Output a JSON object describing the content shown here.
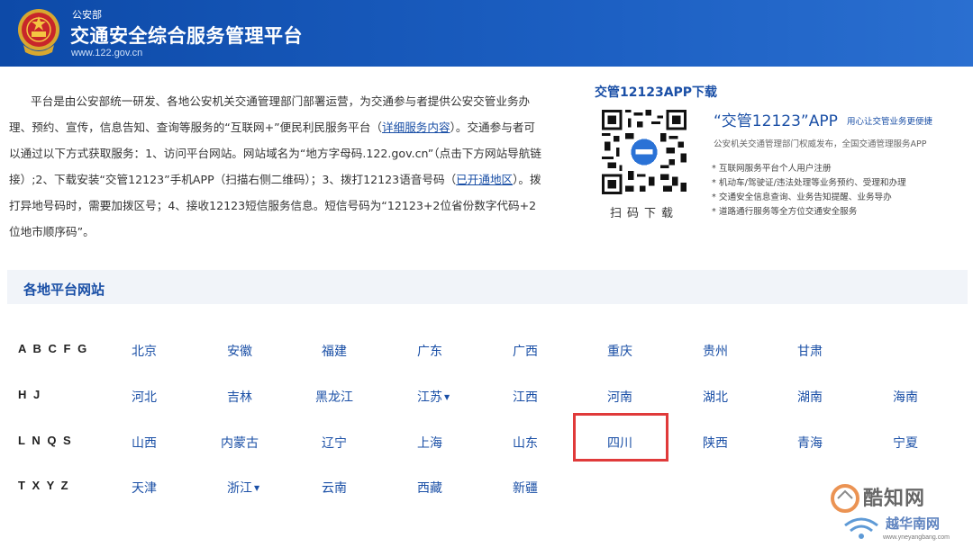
{
  "header": {
    "dept": "公安部",
    "title": "交通安全综合服务管理平台",
    "url": "www.122.gov.cn"
  },
  "intro": {
    "p1": "平台是由公安部统一研发、各地公安机关交通管理部门部署运营，为交通参与者提供公安交管业务办理、预约、宣传，信息告知、查询等服务的“互联网+”便民利民服务平台（",
    "link1": "详细服务内容",
    "p2": "）。交通参与者可以通过以下方式获取服务：1、访问平台网站。网站域名为“地方字母码.122.gov.cn”（点击下方网站导航链接）;2、下载安装“交管12123”手机APP（扫描右侧二维码）；3、拨打12123语音号码（",
    "link2": "已开通地区",
    "p3": "）。拨打异地号码时，需要加拨区号；4、接收12123短信服务信息。短信号码为“12123+2位省份数字代码+2位地市顺序码”。"
  },
  "app": {
    "title": "交管12123APP下载",
    "scan": "扫码下载",
    "name": "“交管12123”APP",
    "slogan": "用心让交管业务更便捷",
    "desc": "公安机关交通管理部门权威发布，全国交通管理服务APP",
    "features": [
      "* 互联网服务平台个人用户注册",
      "* 机动车/驾驶证/违法处理等业务预约、受理和办理",
      "* 交通安全信息查询、业务告知提醒、业务导办",
      "* 道路通行服务等全方位交通安全服务"
    ]
  },
  "section": {
    "title": "各地平台网站"
  },
  "groups": [
    "A B C F G",
    "H J",
    "L N Q S",
    "T X Y Z"
  ],
  "provinces": {
    "r0": [
      "北京",
      "安徽",
      "福建",
      "广东",
      "广西",
      "重庆",
      "贵州",
      "甘肃"
    ],
    "r1": [
      "河北",
      "吉林",
      "黑龙江",
      "江苏",
      "江西",
      "河南",
      "湖北",
      "湖南",
      "海南"
    ],
    "r2": [
      "山西",
      "内蒙古",
      "辽宁",
      "上海",
      "山东",
      "四川",
      "陕西",
      "青海",
      "宁夏"
    ],
    "r3": [
      "天津",
      "浙江",
      "云南",
      "西藏",
      "新疆"
    ]
  },
  "dropdown_marker": "▼",
  "watermark": {
    "line1": "酷知网",
    "line2": "越华南网",
    "line3": "www.yneyangbang.com"
  },
  "colors": {
    "header": "#0d4aa8",
    "link": "#1a4fa6",
    "highlight": "#e03a3a"
  }
}
